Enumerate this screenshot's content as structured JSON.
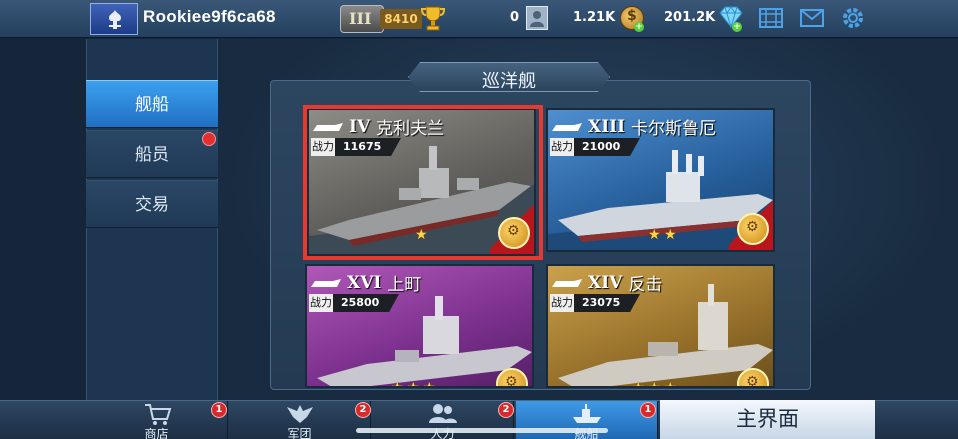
{
  "player": {
    "name": "Rookiee9f6ca68",
    "rank_numeral": "III",
    "rank_score": "8410"
  },
  "resources": {
    "count_a": "0",
    "silver": "1.21K",
    "gold": "201.2K"
  },
  "topbar_icons": [
    "avatar-crest-icon",
    "trophy-icon",
    "crew-card-icon",
    "coin-icon",
    "diamond-icon",
    "video-icon",
    "mail-icon",
    "gear-icon"
  ],
  "sidebar": {
    "items": [
      {
        "label": "舰船",
        "active": true
      },
      {
        "label": "船员",
        "active": false,
        "has_notice": true
      },
      {
        "label": "交易",
        "active": false
      }
    ]
  },
  "section_title": "巡洋舰",
  "ships": [
    {
      "tier": "IV",
      "name": "克利夫兰",
      "power_label": "战力",
      "power": "11675",
      "stars": 1,
      "selected": true,
      "theme": "gray"
    },
    {
      "tier": "XIII",
      "name": "卡尔斯鲁厄",
      "power_label": "战力",
      "power": "21000",
      "stars": 2,
      "selected": false,
      "theme": "blue"
    },
    {
      "tier": "XVI",
      "name": "上町",
      "power_label": "战力",
      "power": "25800",
      "stars": 3,
      "selected": false,
      "theme": "purple"
    },
    {
      "tier": "XIV",
      "name": "反击",
      "power_label": "战力",
      "power": "23075",
      "stars": 3,
      "selected": false,
      "theme": "gold"
    }
  ],
  "bottom_nav": [
    {
      "label": "商店",
      "badge": "1",
      "icon": "cart-icon",
      "active": false
    },
    {
      "label": "军团",
      "badge": "2",
      "icon": "eagle-icon",
      "active": false
    },
    {
      "label": "人力",
      "badge": "2",
      "icon": "people-icon",
      "active": false
    },
    {
      "label": "舰船",
      "badge": "1",
      "icon": "ship-icon",
      "active": true
    }
  ],
  "home_button": "主界面",
  "colors": {
    "accent_blue": "#2f86dc",
    "selection_red": "#e53a32",
    "badge_red": "#d82a2a",
    "star_gold": "#ffd24a"
  }
}
